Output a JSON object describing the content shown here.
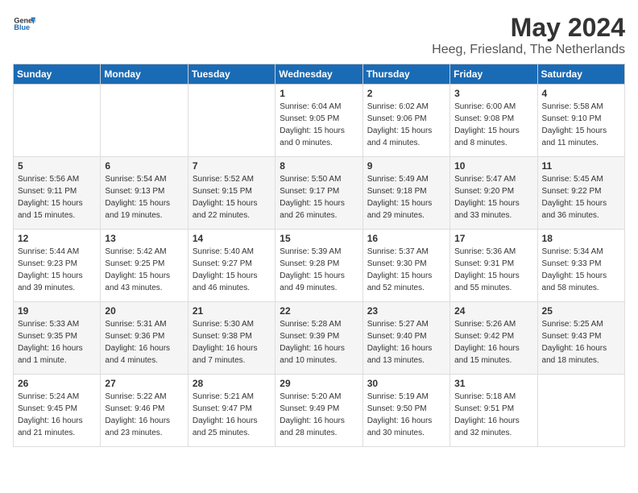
{
  "header": {
    "logo_general": "General",
    "logo_blue": "Blue",
    "month_title": "May 2024",
    "location": "Heeg, Friesland, The Netherlands"
  },
  "weekdays": [
    "Sunday",
    "Monday",
    "Tuesday",
    "Wednesday",
    "Thursday",
    "Friday",
    "Saturday"
  ],
  "weeks": [
    [
      {
        "day": "",
        "info": ""
      },
      {
        "day": "",
        "info": ""
      },
      {
        "day": "",
        "info": ""
      },
      {
        "day": "1",
        "info": "Sunrise: 6:04 AM\nSunset: 9:05 PM\nDaylight: 15 hours\nand 0 minutes."
      },
      {
        "day": "2",
        "info": "Sunrise: 6:02 AM\nSunset: 9:06 PM\nDaylight: 15 hours\nand 4 minutes."
      },
      {
        "day": "3",
        "info": "Sunrise: 6:00 AM\nSunset: 9:08 PM\nDaylight: 15 hours\nand 8 minutes."
      },
      {
        "day": "4",
        "info": "Sunrise: 5:58 AM\nSunset: 9:10 PM\nDaylight: 15 hours\nand 11 minutes."
      }
    ],
    [
      {
        "day": "5",
        "info": "Sunrise: 5:56 AM\nSunset: 9:11 PM\nDaylight: 15 hours\nand 15 minutes."
      },
      {
        "day": "6",
        "info": "Sunrise: 5:54 AM\nSunset: 9:13 PM\nDaylight: 15 hours\nand 19 minutes."
      },
      {
        "day": "7",
        "info": "Sunrise: 5:52 AM\nSunset: 9:15 PM\nDaylight: 15 hours\nand 22 minutes."
      },
      {
        "day": "8",
        "info": "Sunrise: 5:50 AM\nSunset: 9:17 PM\nDaylight: 15 hours\nand 26 minutes."
      },
      {
        "day": "9",
        "info": "Sunrise: 5:49 AM\nSunset: 9:18 PM\nDaylight: 15 hours\nand 29 minutes."
      },
      {
        "day": "10",
        "info": "Sunrise: 5:47 AM\nSunset: 9:20 PM\nDaylight: 15 hours\nand 33 minutes."
      },
      {
        "day": "11",
        "info": "Sunrise: 5:45 AM\nSunset: 9:22 PM\nDaylight: 15 hours\nand 36 minutes."
      }
    ],
    [
      {
        "day": "12",
        "info": "Sunrise: 5:44 AM\nSunset: 9:23 PM\nDaylight: 15 hours\nand 39 minutes."
      },
      {
        "day": "13",
        "info": "Sunrise: 5:42 AM\nSunset: 9:25 PM\nDaylight: 15 hours\nand 43 minutes."
      },
      {
        "day": "14",
        "info": "Sunrise: 5:40 AM\nSunset: 9:27 PM\nDaylight: 15 hours\nand 46 minutes."
      },
      {
        "day": "15",
        "info": "Sunrise: 5:39 AM\nSunset: 9:28 PM\nDaylight: 15 hours\nand 49 minutes."
      },
      {
        "day": "16",
        "info": "Sunrise: 5:37 AM\nSunset: 9:30 PM\nDaylight: 15 hours\nand 52 minutes."
      },
      {
        "day": "17",
        "info": "Sunrise: 5:36 AM\nSunset: 9:31 PM\nDaylight: 15 hours\nand 55 minutes."
      },
      {
        "day": "18",
        "info": "Sunrise: 5:34 AM\nSunset: 9:33 PM\nDaylight: 15 hours\nand 58 minutes."
      }
    ],
    [
      {
        "day": "19",
        "info": "Sunrise: 5:33 AM\nSunset: 9:35 PM\nDaylight: 16 hours\nand 1 minute."
      },
      {
        "day": "20",
        "info": "Sunrise: 5:31 AM\nSunset: 9:36 PM\nDaylight: 16 hours\nand 4 minutes."
      },
      {
        "day": "21",
        "info": "Sunrise: 5:30 AM\nSunset: 9:38 PM\nDaylight: 16 hours\nand 7 minutes."
      },
      {
        "day": "22",
        "info": "Sunrise: 5:28 AM\nSunset: 9:39 PM\nDaylight: 16 hours\nand 10 minutes."
      },
      {
        "day": "23",
        "info": "Sunrise: 5:27 AM\nSunset: 9:40 PM\nDaylight: 16 hours\nand 13 minutes."
      },
      {
        "day": "24",
        "info": "Sunrise: 5:26 AM\nSunset: 9:42 PM\nDaylight: 16 hours\nand 15 minutes."
      },
      {
        "day": "25",
        "info": "Sunrise: 5:25 AM\nSunset: 9:43 PM\nDaylight: 16 hours\nand 18 minutes."
      }
    ],
    [
      {
        "day": "26",
        "info": "Sunrise: 5:24 AM\nSunset: 9:45 PM\nDaylight: 16 hours\nand 21 minutes."
      },
      {
        "day": "27",
        "info": "Sunrise: 5:22 AM\nSunset: 9:46 PM\nDaylight: 16 hours\nand 23 minutes."
      },
      {
        "day": "28",
        "info": "Sunrise: 5:21 AM\nSunset: 9:47 PM\nDaylight: 16 hours\nand 25 minutes."
      },
      {
        "day": "29",
        "info": "Sunrise: 5:20 AM\nSunset: 9:49 PM\nDaylight: 16 hours\nand 28 minutes."
      },
      {
        "day": "30",
        "info": "Sunrise: 5:19 AM\nSunset: 9:50 PM\nDaylight: 16 hours\nand 30 minutes."
      },
      {
        "day": "31",
        "info": "Sunrise: 5:18 AM\nSunset: 9:51 PM\nDaylight: 16 hours\nand 32 minutes."
      },
      {
        "day": "",
        "info": ""
      }
    ]
  ]
}
